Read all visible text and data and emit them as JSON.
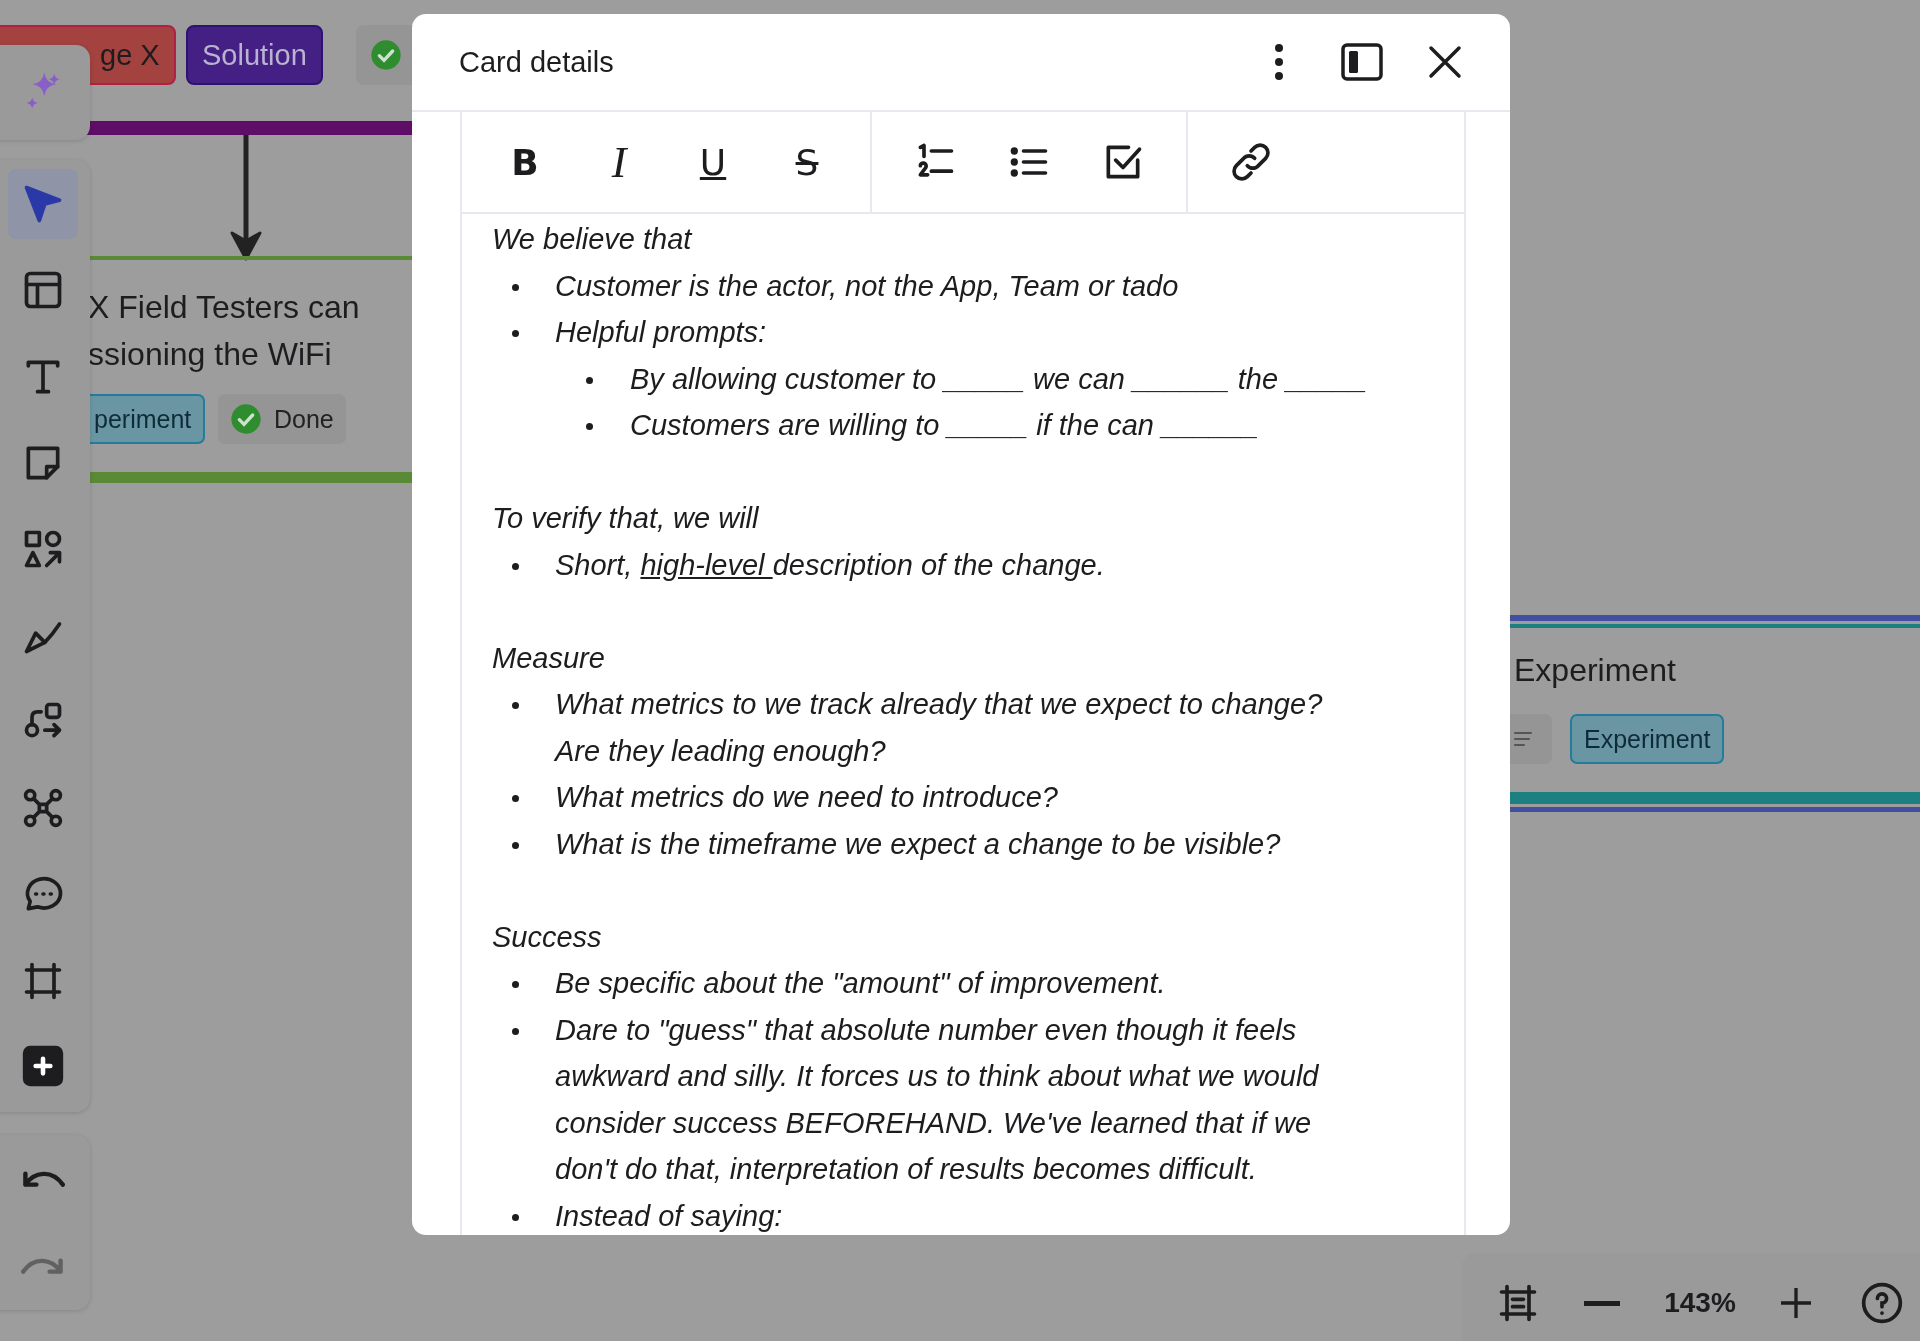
{
  "canvas": {
    "top_tags": [
      {
        "label": "ge X",
        "kind": "challenge"
      },
      {
        "label": "Solution",
        "kind": "solution"
      },
      {
        "kind": "status"
      }
    ],
    "card_left": {
      "title_lines": [
        "X Field Testers can",
        "ssioning the WiFi"
      ],
      "tags": [
        {
          "label": "periment",
          "kind": "experiment"
        },
        {
          "label": "Done",
          "kind": "done"
        }
      ]
    },
    "card_right": {
      "title": "Experiment",
      "tags": [
        {
          "kind": "description"
        },
        {
          "label": "Experiment",
          "kind": "experiment"
        }
      ]
    }
  },
  "toolbar": {
    "tools": [
      {
        "kind": "select",
        "selected": true
      },
      {
        "kind": "layout",
        "selected": false
      },
      {
        "kind": "text",
        "selected": false
      },
      {
        "kind": "sticky",
        "selected": false
      },
      {
        "kind": "shapes",
        "selected": false
      },
      {
        "kind": "pen",
        "selected": false
      },
      {
        "kind": "flow",
        "selected": false
      },
      {
        "kind": "mindmap",
        "selected": false
      },
      {
        "kind": "comment",
        "selected": false
      },
      {
        "kind": "frame",
        "selected": false
      },
      {
        "kind": "add",
        "selected": false
      }
    ],
    "history": [
      {
        "kind": "undo",
        "disabled": false
      },
      {
        "kind": "redo",
        "disabled": true
      }
    ]
  },
  "zoom_bar": {
    "level": "143%"
  },
  "dialog": {
    "title": "Card details",
    "format_groups": [
      [
        {
          "kind": "bold",
          "label": "B"
        },
        {
          "kind": "italic",
          "label": "I"
        },
        {
          "kind": "underline",
          "label": "U"
        },
        {
          "kind": "strike",
          "label": "S"
        }
      ],
      [
        {
          "kind": "numbered"
        },
        {
          "kind": "bulleted"
        },
        {
          "kind": "checklist"
        }
      ],
      [
        {
          "kind": "link"
        }
      ]
    ],
    "blocks": [
      {
        "kind": "heading",
        "text": "We believe that"
      },
      {
        "kind": "list",
        "items": [
          {
            "parts": [
              {
                "text": "Customer is the actor, not the App, Team or tado"
              }
            ]
          },
          {
            "parts": [
              {
                "text": "Helpful prompts:"
              }
            ],
            "children": [
              {
                "parts": [
                  {
                    "text": "By allowing customer to _____ we can ______ the _____"
                  }
                ]
              },
              {
                "parts": [
                  {
                    "text": "Customers are willing to _____ if the can ______"
                  }
                ]
              }
            ]
          }
        ]
      },
      {
        "kind": "blank"
      },
      {
        "kind": "heading",
        "text": "To verify that, we will"
      },
      {
        "kind": "list",
        "items": [
          {
            "parts": [
              {
                "text": "Short, "
              },
              {
                "text": "high-level ",
                "kind": "link"
              },
              {
                "text": "description of the change."
              }
            ]
          }
        ]
      },
      {
        "kind": "blank"
      },
      {
        "kind": "heading",
        "text": "Measure"
      },
      {
        "kind": "list",
        "items": [
          {
            "parts": [
              {
                "text": "What metrics to we track already that we expect to change? Are they leading enough?"
              }
            ]
          },
          {
            "parts": [
              {
                "text": "What metrics do we need to introduce?"
              }
            ]
          },
          {
            "parts": [
              {
                "text": "What is the timeframe we expect a change to be visible?"
              }
            ]
          }
        ]
      },
      {
        "kind": "blank"
      },
      {
        "kind": "heading",
        "text": "Success"
      },
      {
        "kind": "list",
        "items": [
          {
            "parts": [
              {
                "text": "Be specific about the \"amount\" of improvement."
              }
            ]
          },
          {
            "parts": [
              {
                "text": "Dare to \"guess\" that absolute number even though it feels awkward and silly. It forces us to think about what we would consider success BEFOREHAND. We've learned that if we don't do that, interpretation of results becomes difficult."
              }
            ]
          },
          {
            "parts": [
              {
                "text": "Instead of saying:"
              }
            ]
          }
        ]
      }
    ]
  }
}
